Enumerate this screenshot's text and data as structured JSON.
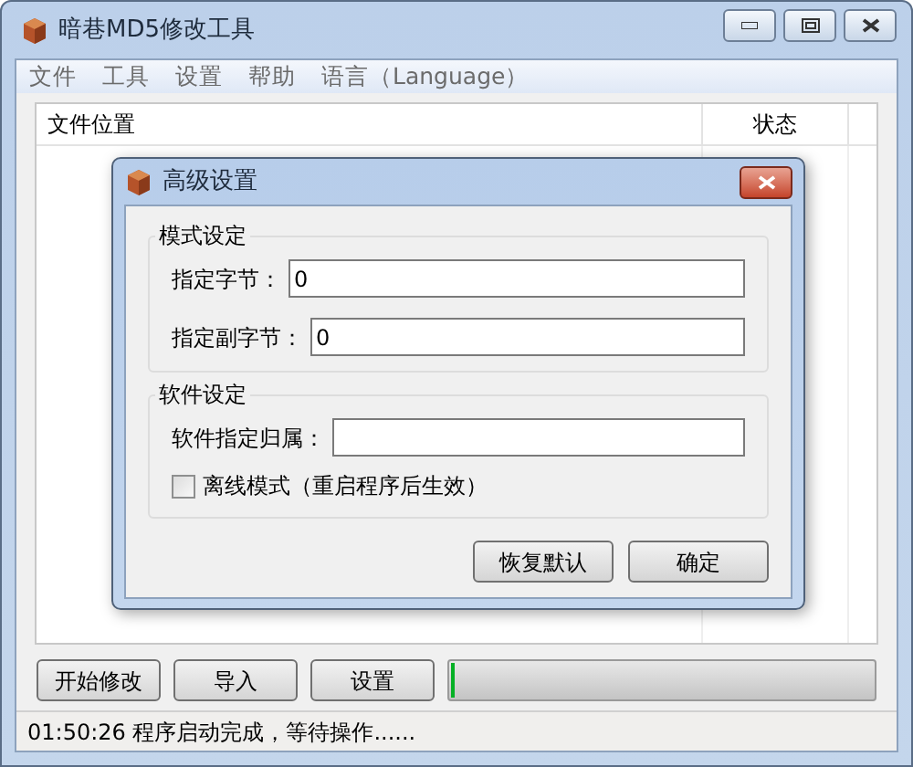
{
  "window": {
    "title": "暗巷MD5修改工具"
  },
  "menu": [
    "文件",
    "工具",
    "设置",
    "帮助",
    "语言（Language）"
  ],
  "table": {
    "columns": [
      "文件位置",
      "状态"
    ]
  },
  "buttons": [
    "开始修改",
    "导入",
    "设置"
  ],
  "progress": {
    "level": 0.01
  },
  "status_bar": "01:50:26 程序启动完成，等待操作......",
  "dialog": {
    "title": "高级设置",
    "groups": [
      {
        "title": "模式设定",
        "fields": [
          {
            "kind": "field",
            "label": "指定字节：",
            "value": "0"
          },
          {
            "kind": "field",
            "label": "指定副字节：",
            "value": "0"
          }
        ]
      },
      {
        "title": "软件设定",
        "fields": [
          {
            "kind": "field",
            "label": "软件指定归属："
          },
          {
            "kind": "checkbox",
            "label": "离线模式（重启程序后生效）",
            "checked": false
          }
        ]
      }
    ],
    "buttons": [
      "恢复默认",
      "确定"
    ]
  }
}
